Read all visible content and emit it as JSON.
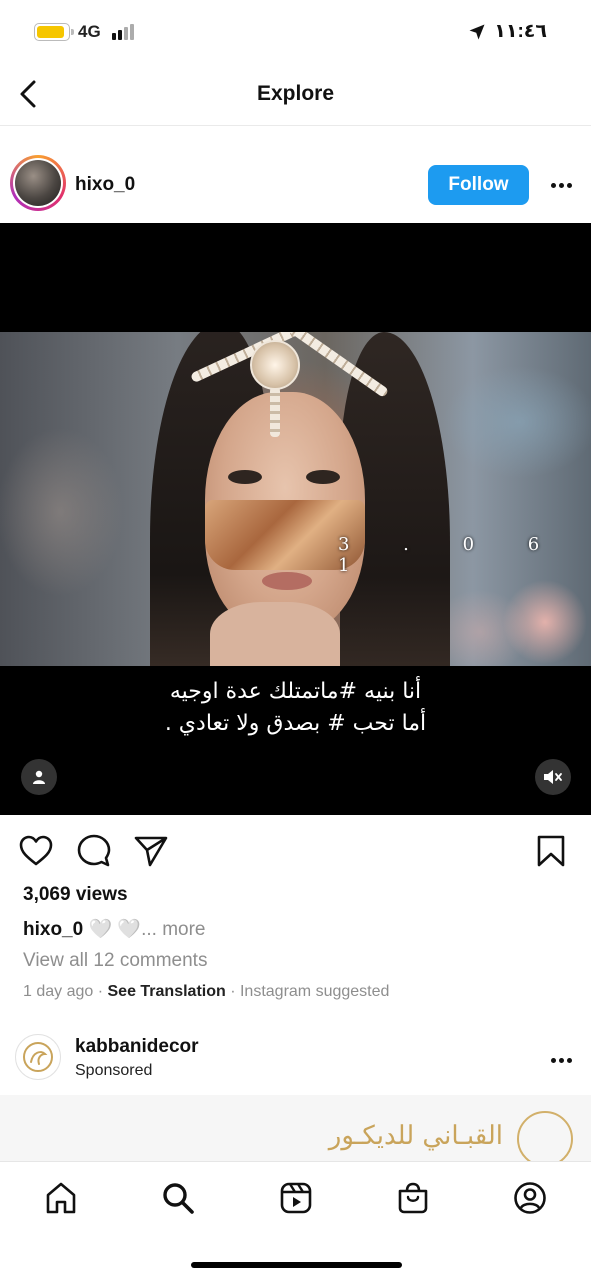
{
  "status_bar": {
    "network": "4G",
    "time": "١١:٤٦",
    "battery_color": "#f6c600"
  },
  "header": {
    "title": "Explore",
    "back_icon": "chevron-left-icon"
  },
  "post": {
    "username": "hixo_0",
    "follow_label": "Follow",
    "accent_color": "#1d9bf0",
    "video_overlay_text": "3 . 0 6 1",
    "video_caption_line1": "أنا بنيه #ماتمتلك عدة اوجيه",
    "video_caption_line2": "أما تحب # بصدق ولا تعادي .",
    "views": "3,069 views",
    "caption_user": "hixo_0",
    "caption_text": " 🤍 🤍",
    "caption_more": "... more",
    "comments_link": "View all 12 comments",
    "time_ago": "1 day ago",
    "separator": " · ",
    "see_translation": "See Translation",
    "suggested": "Instagram suggested"
  },
  "sponsored": {
    "brand": "kabbanidecor",
    "label": "Sponsored",
    "ad_text": "القبـاني للديكـور"
  },
  "bottom_nav": {
    "items": [
      "home-icon",
      "search-icon",
      "reels-icon",
      "shop-icon",
      "profile-icon"
    ]
  }
}
